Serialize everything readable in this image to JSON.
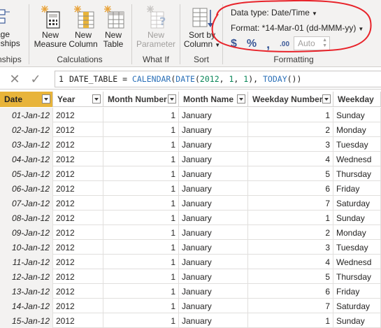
{
  "ribbon": {
    "buttons": [
      {
        "label1": "age",
        "label2": "nships",
        "name": "manage-relationships-button",
        "icon": "relationships-icon",
        "disabled": false
      },
      {
        "label1": "New",
        "label2": "Measure",
        "name": "new-measure-button",
        "icon": "calculator-icon",
        "disabled": false
      },
      {
        "label1": "New",
        "label2": "Column",
        "name": "new-column-button",
        "icon": "table-column-icon",
        "disabled": false
      },
      {
        "label1": "New",
        "label2": "Table",
        "name": "new-table-button",
        "icon": "table-icon",
        "disabled": false
      },
      {
        "label1": "New",
        "label2": "Parameter",
        "name": "new-parameter-button",
        "icon": "parameter-icon",
        "disabled": true
      },
      {
        "label1": "Sort by",
        "label2": "Column",
        "name": "sort-by-column-button",
        "icon": "sort-icon",
        "disabled": false
      }
    ],
    "groups": {
      "relationships": "nships",
      "calculations": "Calculations",
      "whatif": "What If",
      "sort": "Sort",
      "formatting": "Formatting"
    },
    "formatting": {
      "data_type_label": "Data type: Date/Time",
      "format_label": "Format: *14-Mar-01 (dd-MMM-yy)",
      "currency_symbol": "$",
      "percent_symbol": "%",
      "comma_symbol": ",",
      "decimal_symbol": ".00",
      "decimal_places": "Auto"
    },
    "accent_colors": {
      "annotation_ellipse": "#e8232a",
      "selected_column": "#e8b43a"
    }
  },
  "formula_bar": {
    "line_number": "1",
    "tokens": [
      {
        "t": "DATE_TABLE = ",
        "k": "plain"
      },
      {
        "t": "CALENDAR",
        "k": "fn"
      },
      {
        "t": "(",
        "k": "pun"
      },
      {
        "t": "DATE",
        "k": "fn"
      },
      {
        "t": "(",
        "k": "pun"
      },
      {
        "t": "2012",
        "k": "num"
      },
      {
        "t": ", ",
        "k": "pun"
      },
      {
        "t": "1",
        "k": "num"
      },
      {
        "t": ", ",
        "k": "pun"
      },
      {
        "t": "1",
        "k": "num"
      },
      {
        "t": "), ",
        "k": "pun"
      },
      {
        "t": "TODAY",
        "k": "fn"
      },
      {
        "t": "())",
        "k": "pun"
      }
    ]
  },
  "table": {
    "columns": [
      "Date",
      "Year",
      "Month Number",
      "Month Name",
      "Weekday Number",
      "Weekday"
    ],
    "rows": [
      [
        "01-Jan-12",
        "2012",
        "1",
        "January",
        "1",
        "Sunday"
      ],
      [
        "02-Jan-12",
        "2012",
        "1",
        "January",
        "2",
        "Monday"
      ],
      [
        "03-Jan-12",
        "2012",
        "1",
        "January",
        "3",
        "Tuesday"
      ],
      [
        "04-Jan-12",
        "2012",
        "1",
        "January",
        "4",
        "Wednesd"
      ],
      [
        "05-Jan-12",
        "2012",
        "1",
        "January",
        "5",
        "Thursday"
      ],
      [
        "06-Jan-12",
        "2012",
        "1",
        "January",
        "6",
        "Friday"
      ],
      [
        "07-Jan-12",
        "2012",
        "1",
        "January",
        "7",
        "Saturday"
      ],
      [
        "08-Jan-12",
        "2012",
        "1",
        "January",
        "1",
        "Sunday"
      ],
      [
        "09-Jan-12",
        "2012",
        "1",
        "January",
        "2",
        "Monday"
      ],
      [
        "10-Jan-12",
        "2012",
        "1",
        "January",
        "3",
        "Tuesday"
      ],
      [
        "11-Jan-12",
        "2012",
        "1",
        "January",
        "4",
        "Wednesd"
      ],
      [
        "12-Jan-12",
        "2012",
        "1",
        "January",
        "5",
        "Thursday"
      ],
      [
        "13-Jan-12",
        "2012",
        "1",
        "January",
        "6",
        "Friday"
      ],
      [
        "14-Jan-12",
        "2012",
        "1",
        "January",
        "7",
        "Saturday"
      ],
      [
        "15-Jan-12",
        "2012",
        "1",
        "January",
        "1",
        "Sunday"
      ]
    ]
  }
}
